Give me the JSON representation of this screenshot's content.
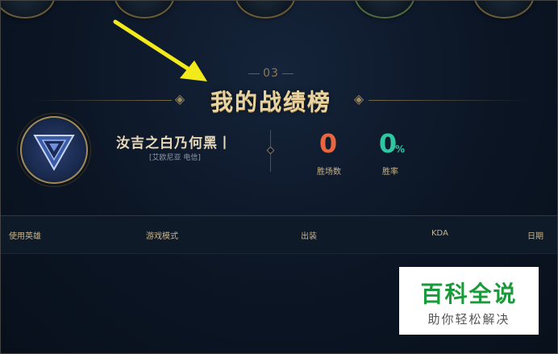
{
  "section": {
    "number": "03",
    "title": "我的战绩榜"
  },
  "profile": {
    "name": "汝吉之白乃何黑丨",
    "server": "[艾欧尼亚 电信]",
    "avatar_icon": "hero-avatar-icon"
  },
  "stats": {
    "wins_value": "0",
    "wins_label": "胜场数",
    "rate_value": "0",
    "rate_unit": "%",
    "rate_label": "胜率"
  },
  "table": {
    "columns": [
      "使用英雄",
      "游戏模式",
      "出装",
      "KDA",
      "日期"
    ]
  },
  "watermark": {
    "main": "百科全说",
    "sub": "助你轻松解决"
  },
  "colors": {
    "accent_gold": "#e8d3a2",
    "wins_color": "#e8663f",
    "rate_color": "#2fc6a2",
    "arrow_color": "#f2ea1a",
    "watermark_green": "#1a9a3a"
  }
}
